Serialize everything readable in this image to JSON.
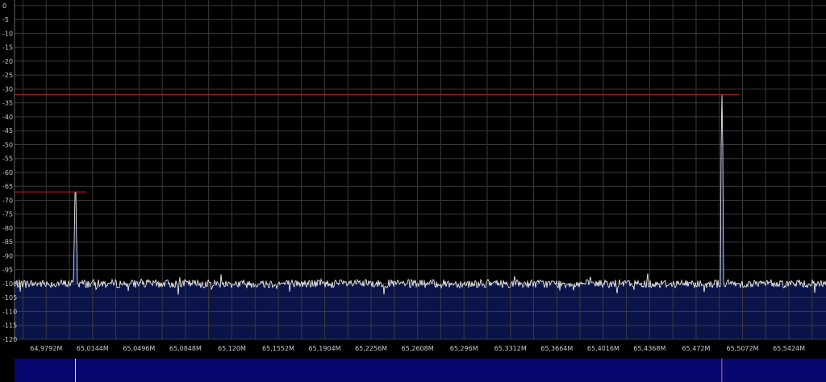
{
  "chart_data": {
    "type": "line",
    "title": "",
    "xlabel": "",
    "ylabel": "",
    "y_unit_note": "dB",
    "y_ticks": [
      0,
      -5,
      -10,
      -15,
      -20,
      -25,
      -30,
      -35,
      -40,
      -45,
      -50,
      -55,
      -60,
      -65,
      -70,
      -75,
      -80,
      -85,
      -90,
      -95,
      -100,
      -105,
      -110,
      -115,
      -120
    ],
    "x_ticks": [
      "64,9792M",
      "65,0144M",
      "65,0496M",
      "65,0848M",
      "65,120M",
      "65,1552M",
      "65,1904M",
      "65,2256M",
      "65,2608M",
      "65,296M",
      "65,3312M",
      "65,3664M",
      "65,4016M",
      "65,4368M",
      "65,472M",
      "65,5072M",
      "65,5424M"
    ],
    "x_tick_values_mhz": [
      64.9792,
      65.0144,
      65.0496,
      65.0848,
      65.12,
      65.1552,
      65.1904,
      65.2256,
      65.2608,
      65.296,
      65.3312,
      65.3664,
      65.4016,
      65.4368,
      65.472,
      65.5072,
      65.5424
    ],
    "xlim_mhz": [
      64.9552,
      65.5705
    ],
    "ylim": [
      -120,
      2
    ],
    "grid": true,
    "noise_floor_db": -100,
    "peaks": [
      {
        "freq_mhz": 65.0014,
        "level_db": -67
      },
      {
        "freq_mhz": 65.4915,
        "level_db": -32
      }
    ],
    "peak_hold_markers": [
      {
        "from_mhz": 64.9552,
        "to_mhz": 65.0099,
        "level_db": -67
      },
      {
        "from_mhz": 64.9552,
        "to_mhz": 65.5049,
        "level_db": -32
      }
    ],
    "waterfall_markers_mhz": [
      65.0014,
      65.4915
    ],
    "colors": {
      "background": "#000000",
      "grid": "#3a3a3a",
      "trace": "#ffffff",
      "fill": "#0b1448",
      "peak_hold": "#c0201c",
      "waterfall": "#06066e",
      "label": "#c8c8c8"
    }
  }
}
